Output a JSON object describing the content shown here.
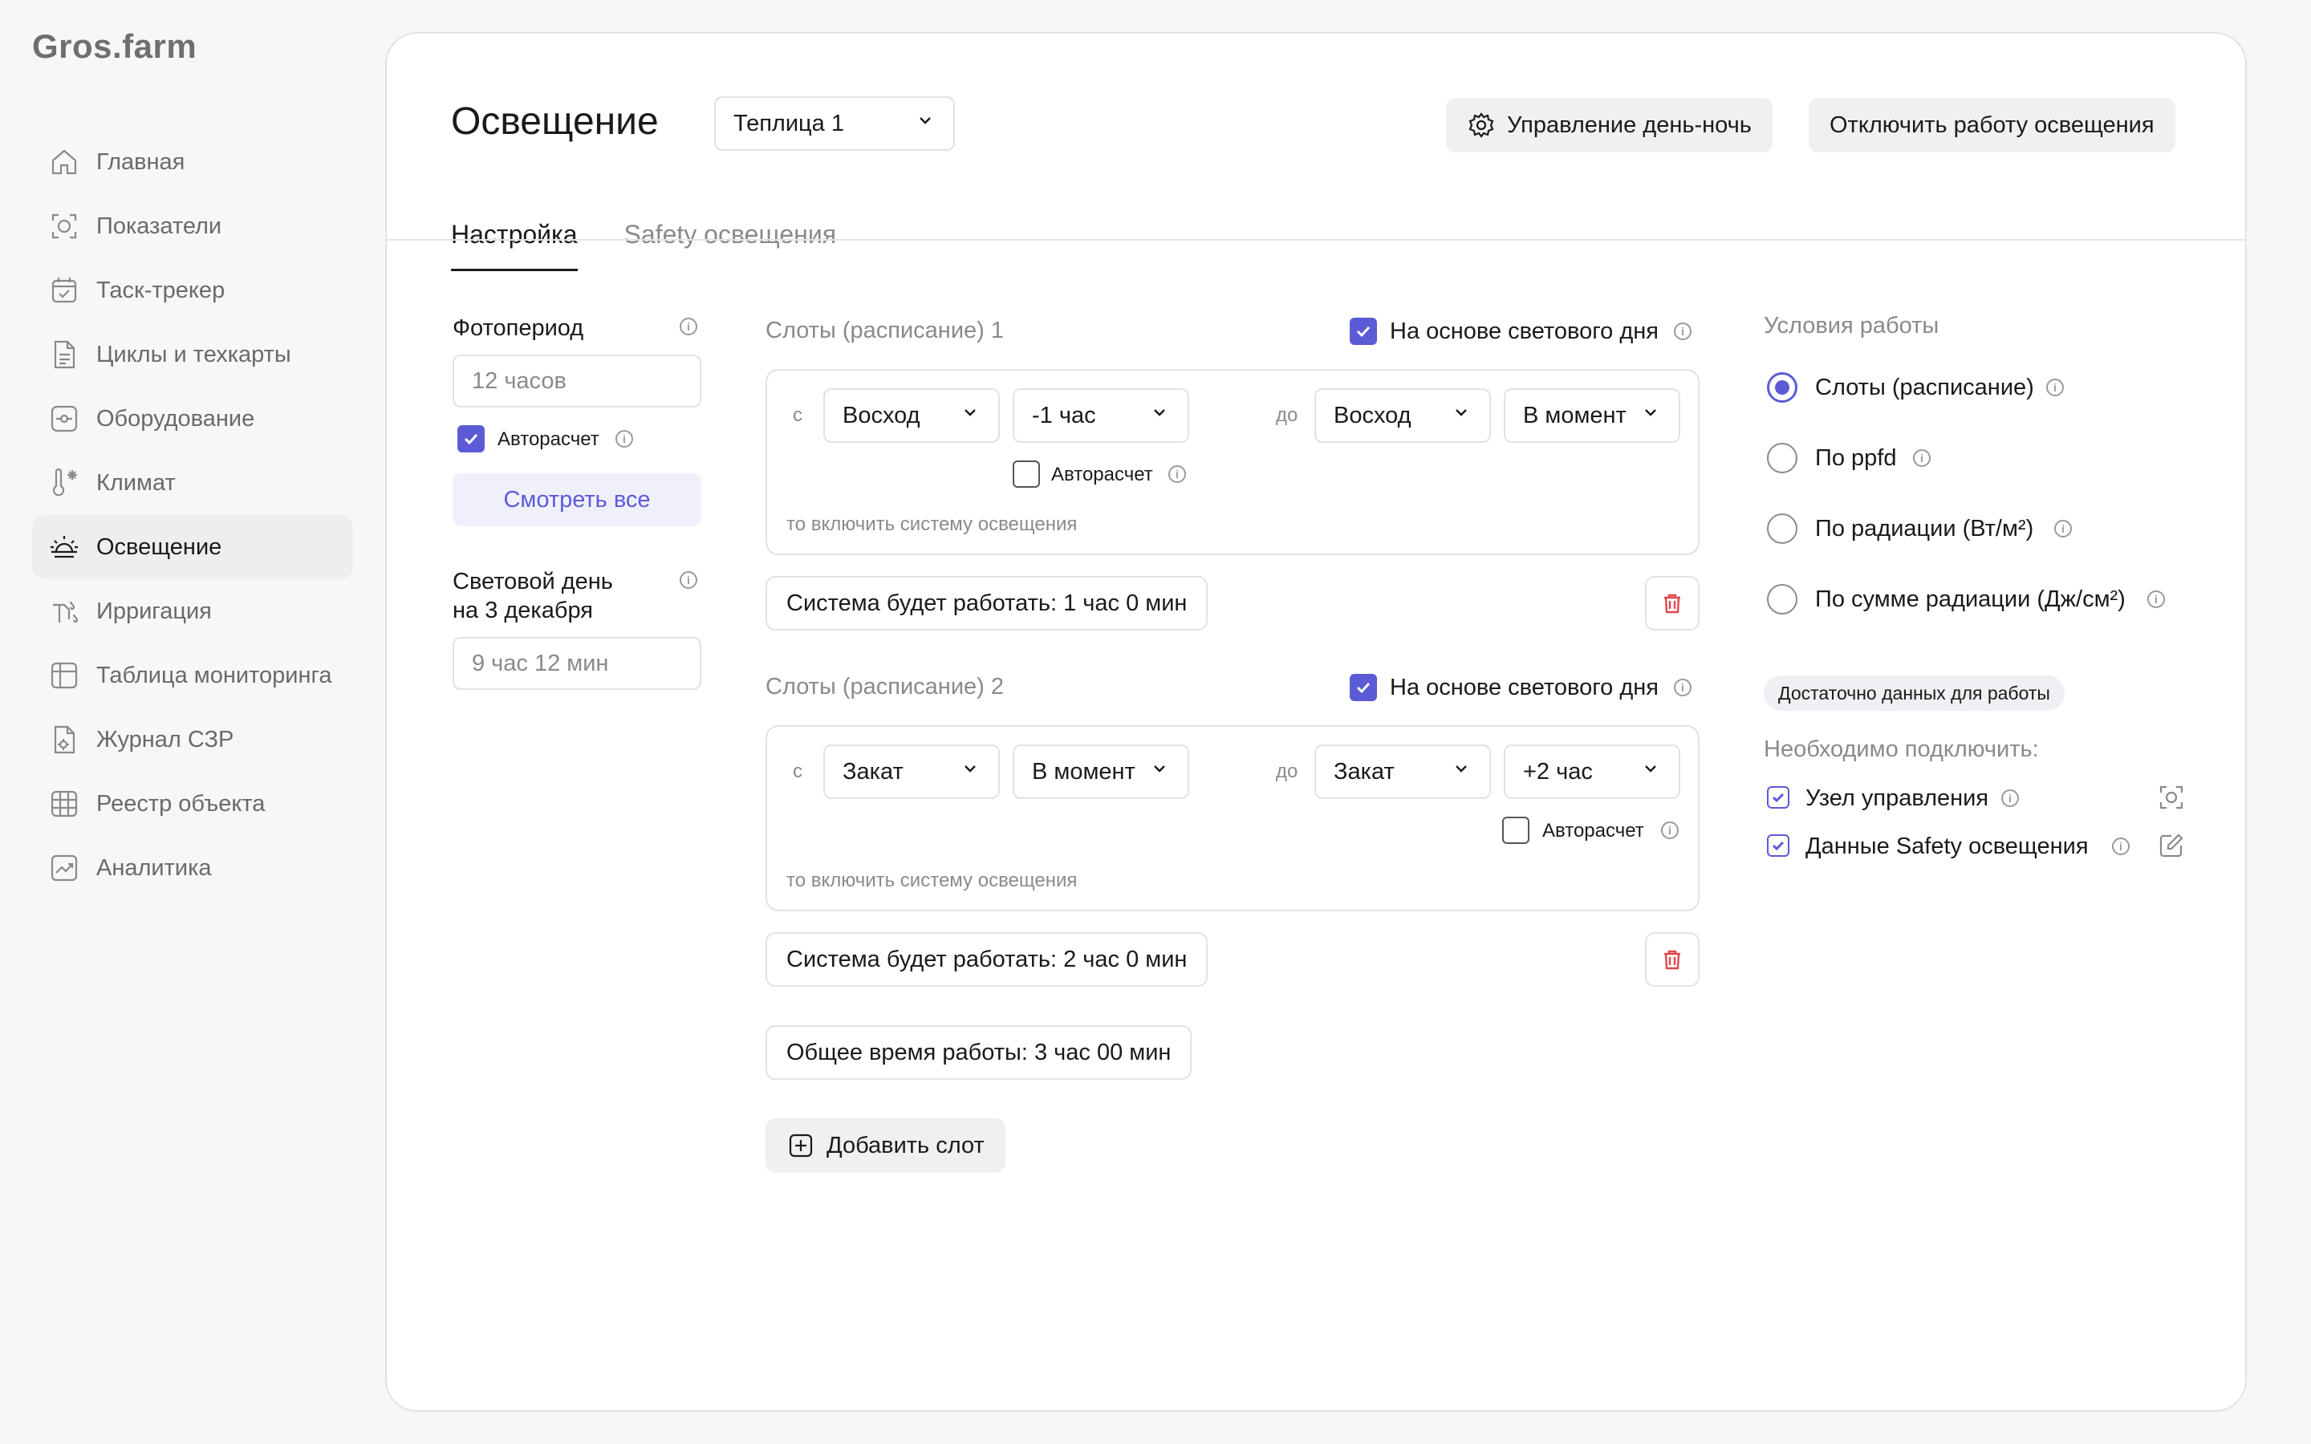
{
  "app": {
    "logo": "Gros.farm"
  },
  "sidebar": {
    "items": [
      {
        "label": "Главная",
        "icon": "home-icon"
      },
      {
        "label": "Показатели",
        "icon": "camera-icon"
      },
      {
        "label": "Таск-трекер",
        "icon": "calendar-icon"
      },
      {
        "label": "Циклы и техкарты",
        "icon": "document-icon"
      },
      {
        "label": "Оборудование",
        "icon": "equipment-icon"
      },
      {
        "label": "Климат",
        "icon": "thermometer-icon"
      },
      {
        "label": "Освещение",
        "icon": "sunrise-icon",
        "active": true
      },
      {
        "label": "Ирригация",
        "icon": "irrigation-icon"
      },
      {
        "label": "Таблица мониторинга",
        "icon": "table-icon"
      },
      {
        "label": "Журнал СЗР",
        "icon": "journal-icon"
      },
      {
        "label": "Реестр объекта",
        "icon": "grid-icon"
      },
      {
        "label": "Аналитика",
        "icon": "chart-icon"
      }
    ]
  },
  "header": {
    "title": "Освещение",
    "greenhouse_select": "Теплица 1",
    "daynight_button": "Управление день-ночь",
    "disable_button": "Отключить работу освещения"
  },
  "tabs": [
    "Настройка",
    "Safety освещения"
  ],
  "left": {
    "photoperiod_label": "Фотопериод",
    "photoperiod_placeholder": "12 часов",
    "auto_label": "Авторасчет",
    "view_all": "Смотреть все",
    "lightday_label_1": "Световой день",
    "lightday_label_2": "на 3 декабря",
    "lightday_value": "9 час 12 мин"
  },
  "slots": [
    {
      "title": "Слоты (расписание) 1",
      "daylight_label": "На основе светового дня",
      "from_label": "с",
      "from_event": "Восход",
      "from_offset": "-1 час",
      "to_label": "до",
      "to_event": "Восход",
      "to_offset": "В момент",
      "auto_label": "Авторасчет",
      "hint": "то включить систему освещения",
      "work_time": "Система будет работать: 1 час 0 мин"
    },
    {
      "title": "Слоты (расписание) 2",
      "daylight_label": "На основе светового дня",
      "from_label": "с",
      "from_event": "Закат",
      "from_offset": "В момент",
      "to_label": "до",
      "to_event": "Закат",
      "to_offset": "+2 час",
      "auto_label": "Авторасчет",
      "hint": "то включить систему освещения",
      "work_time": "Система будет работать: 2 час 0 мин"
    }
  ],
  "total_time": "Общее время работы: 3 час 00 мин",
  "add_slot": "Добавить слот",
  "conditions": {
    "title": "Условия работы",
    "options": [
      "Слоты (расписание)",
      "По ppfd",
      "По радиации (Вт/м²)",
      "По сумме радиации (Дж/см²)"
    ],
    "selected": 0,
    "badge": "Достаточно данных для работы",
    "need_label": "Необходимо подключить:",
    "items": [
      "Узел управления",
      "Данные Safety освещения"
    ]
  },
  "colors": {
    "accent": "#5b5bd6",
    "danger": "#e0484b",
    "muted": "#8a8a8a"
  }
}
